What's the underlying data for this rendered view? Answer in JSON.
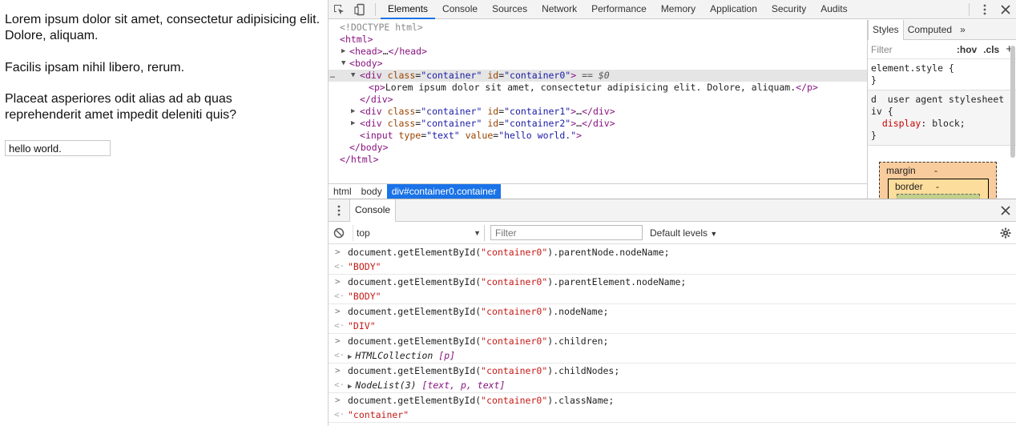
{
  "page": {
    "paragraphs": [
      "Lorem ipsum dolor sit amet, consectetur adipisicing elit. Dolore, aliquam.",
      "Facilis ipsam nihil libero, rerum.",
      "Placeat asperiores odit alias ad ab quas reprehenderit amet impedit deleniti quis?"
    ],
    "input_value": "hello world."
  },
  "toolbar": {
    "tabs": [
      "Elements",
      "Console",
      "Sources",
      "Network",
      "Performance",
      "Memory",
      "Application",
      "Security",
      "Audits"
    ],
    "active_tab": "Elements"
  },
  "elements": {
    "doctype": "<!DOCTYPE html>",
    "selected_marker": "== $0",
    "p_text": "Lorem ipsum dolor sit amet, consectetur adipisicing elit. Dolore, aliquam.",
    "ellipsis": "…",
    "tags": {
      "html": "html",
      "head": "head",
      "body": "body",
      "div": "div",
      "p": "p",
      "input": "input"
    },
    "attrs": {
      "class": "class",
      "id": "id",
      "type": "type",
      "value": "value"
    },
    "vals": {
      "container": "\"container\"",
      "container0": "\"container0\"",
      "container1": "\"container1\"",
      "container2": "\"container2\"",
      "text": "\"text\"",
      "hello": "\"hello world.\""
    }
  },
  "breadcrumbs": [
    "html",
    "body",
    "div#container0.container"
  ],
  "styles": {
    "tabs": [
      "Styles",
      "Computed"
    ],
    "filter_placeholder": "Filter",
    "hov": ":hov",
    "cls": ".cls",
    "element_style": "element.style {",
    "close_brace": "}",
    "ua_header": "d  user agent stylesheet",
    "ua_selector": "iv {",
    "ua_prop": "display",
    "ua_value": "block;",
    "box_margin": "margin",
    "box_border": "border",
    "dash": "-"
  },
  "drawer": {
    "tab": "Console",
    "context": "top",
    "filter_placeholder": "Filter",
    "levels": "Default levels"
  },
  "console": {
    "prefix": "document.getElementById(",
    "arg": "\"container0\"",
    "entries": [
      {
        "suffix": ").parentNode.nodeName;",
        "result": "\"BODY\""
      },
      {
        "suffix": ").parentElement.nodeName;",
        "result": "\"BODY\""
      },
      {
        "suffix": ").nodeName;",
        "result": "\"DIV\""
      },
      {
        "suffix": ").children;",
        "result_name": "HTMLCollection",
        "result_detail": "[p]"
      },
      {
        "suffix": ").childNodes;",
        "result_name": "NodeList(3)",
        "result_detail": "[text, p, text]"
      },
      {
        "suffix": ").className;",
        "result": "\"container\""
      }
    ]
  }
}
